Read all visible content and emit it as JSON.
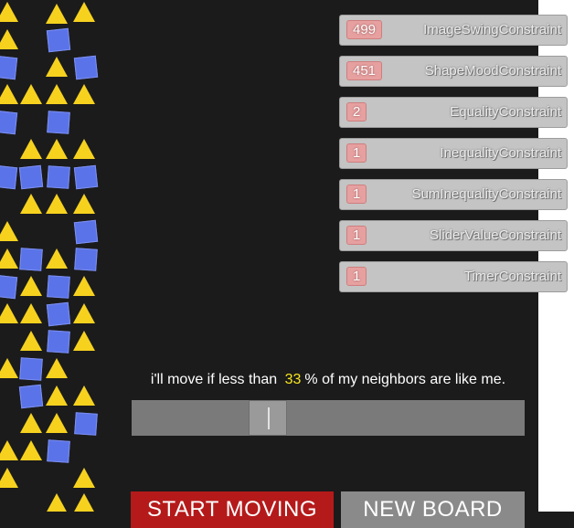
{
  "constraints": [
    {
      "count": "499",
      "name": "ImageSwingConstraint"
    },
    {
      "count": "451",
      "name": "ShapeMoodConstraint"
    },
    {
      "count": "2",
      "name": "EqualityConstraint"
    },
    {
      "count": "1",
      "name": "InequalityConstraint"
    },
    {
      "count": "1",
      "name": "SumInequalityConstraint"
    },
    {
      "count": "1",
      "name": "SliderValueConstraint"
    },
    {
      "count": "1",
      "name": "TimerConstraint"
    }
  ],
  "rule": {
    "prefix": "i'll move if less than",
    "percent": "33",
    "unit": "%",
    "suffix": "of my neighbors are like me."
  },
  "slider": {
    "value_percent": 33
  },
  "buttons": {
    "start": "START MOVING",
    "new_board": "NEW BOARD"
  },
  "colors": {
    "triangle": "#f6d21f",
    "square": "#5b73e8",
    "start": "#b51a1a",
    "percent": "#f7e51e"
  },
  "icons": {
    "triangle": "triangle-shape-icon",
    "square": "square-shape-icon"
  }
}
